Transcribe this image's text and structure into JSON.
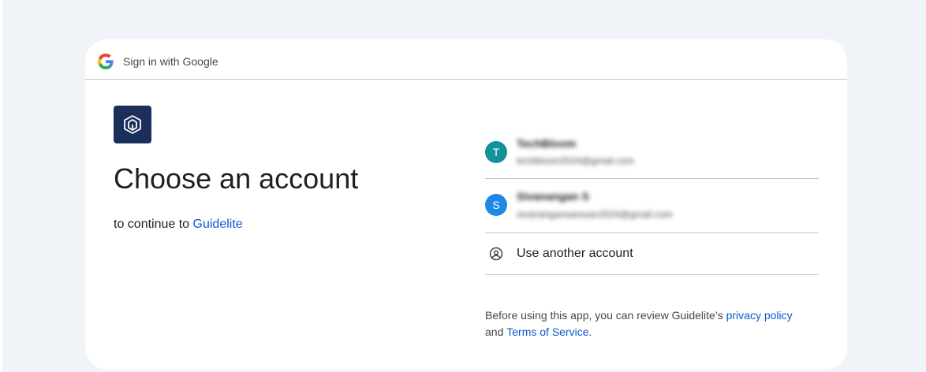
{
  "header": {
    "title": "Sign in with Google",
    "logo_icon": "google-g-icon"
  },
  "app": {
    "logo_icon": "guidelite-logo-icon",
    "logo_bg_color": "#1b2e5c"
  },
  "main": {
    "headline": "Choose an account",
    "subtitle_prefix": "to continue to",
    "app_name": "Guidelite"
  },
  "accounts": [
    {
      "initial": "T",
      "name": "TechBloom",
      "email": "techbloom2024@gmail.com",
      "avatar_color": "#12939a"
    },
    {
      "initial": "S",
      "name": "Sivanangan S",
      "email": "sivanangansaravan2024@gmail.com",
      "avatar_color": "#1e88e5"
    }
  ],
  "use_another": {
    "label": "Use another account",
    "icon": "account-circle-icon"
  },
  "footer": {
    "text_before": "Before using this app, you can review Guidelite’s",
    "privacy_link": "privacy policy",
    "and": "and",
    "terms_link": "Terms of Service",
    "end": "."
  },
  "colors": {
    "page_bg": "#f0f4f9",
    "link": "#0b57d0",
    "divider": "#c4c7c5"
  }
}
